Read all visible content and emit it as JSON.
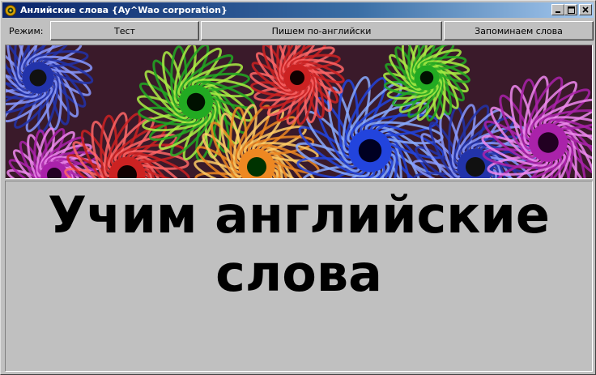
{
  "window": {
    "title": "Анлийские слова {Ay^Wao corporation}",
    "buttons": {
      "minimize": "_",
      "maximize": "□",
      "close": "✕"
    }
  },
  "toolbar": {
    "mode_label": "Режим:",
    "modes": [
      {
        "label": "Тест"
      },
      {
        "label": "Пишем по-английски"
      },
      {
        "label": "Запоминаем слова"
      }
    ]
  },
  "banner": {
    "flowers": [
      {
        "color": "#2233aa",
        "inner": "#111",
        "petal": "#8899ff"
      },
      {
        "color": "#aa22aa",
        "inner": "#220022",
        "petal": "#ee88ee"
      },
      {
        "color": "#cc2222",
        "inner": "#110000",
        "petal": "#ff6666"
      },
      {
        "color": "#22aa22",
        "inner": "#001100",
        "petal": "#aaee44"
      },
      {
        "color": "#ee8822",
        "inner": "#003300",
        "petal": "#ffcc66"
      },
      {
        "color": "#2244dd",
        "inner": "#000022",
        "petal": "#88aaff"
      }
    ]
  },
  "main": {
    "headline": "Учим английские слова"
  }
}
